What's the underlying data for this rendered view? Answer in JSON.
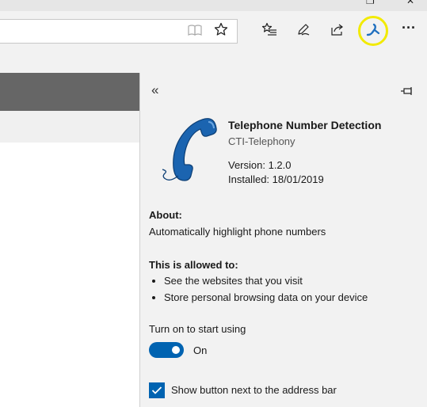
{
  "window": {
    "controls": [
      "❐",
      "✕"
    ]
  },
  "toolbar": {
    "icons": [
      "reading-view-icon",
      "favorite-star-icon",
      "favorites-hub-icon",
      "pen-notes-icon",
      "share-icon",
      "extension-icon",
      "more-icon"
    ],
    "more_label": "···"
  },
  "panel": {
    "back_label": "«",
    "extension": {
      "name": "Telephone Number Detection",
      "publisher": "CTI-Telephony",
      "version_text": "Version: 1.2.0",
      "installed_text": "Installed: 18/01/2019"
    },
    "about": {
      "heading": "About:",
      "text": "Automatically highlight phone numbers"
    },
    "permissions": {
      "heading": "This is allowed to:",
      "items": [
        "See the websites that you visit",
        "Store personal browsing data on your device"
      ]
    },
    "toggle": {
      "label": "Turn on to start using",
      "state_text": "On",
      "value": true
    },
    "checkbox": {
      "label": "Show button next to the address bar",
      "checked": true
    }
  },
  "colors": {
    "accent": "#0063b1",
    "highlight_ring": "#f2ea00",
    "page_header": "#666666"
  }
}
